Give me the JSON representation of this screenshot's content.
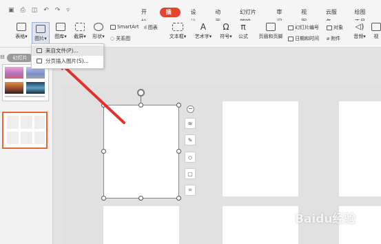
{
  "tabs": [
    {
      "label": "开始",
      "active": false
    },
    {
      "label": "插入",
      "active": true
    },
    {
      "label": "设计",
      "active": false
    },
    {
      "label": "动画",
      "active": false
    },
    {
      "label": "幻灯片放映",
      "active": false
    },
    {
      "label": "审阅",
      "active": false
    },
    {
      "label": "视图",
      "active": false
    },
    {
      "label": "云服务",
      "active": false
    },
    {
      "label": "绘图工具",
      "active": false
    }
  ],
  "ribbon": {
    "table": "表格",
    "picture": "图片",
    "gallery": "图库",
    "screenshot": "截屏",
    "shape": "形状",
    "smartart": "SmartArt",
    "chart": "图表",
    "relation": "关系图",
    "textbox": "文本框",
    "wordart": "艺术字",
    "symbol": "符号",
    "formula": "公式",
    "header_footer": "页眉和页脚",
    "slide_number": "幻灯片编号",
    "object": "对象",
    "datetime": "日期和时间",
    "attachment": "附件",
    "audio": "音频",
    "more": "视"
  },
  "dropdown": {
    "from_file": "来自文件(P)...",
    "paged_insert": "分页插入图片(S)..."
  },
  "sidebar": {
    "tab_label": "幻灯片"
  },
  "watermark": "Baidu经验",
  "colors": {
    "accent": "#e2442f",
    "arrow": "#e3302a"
  }
}
